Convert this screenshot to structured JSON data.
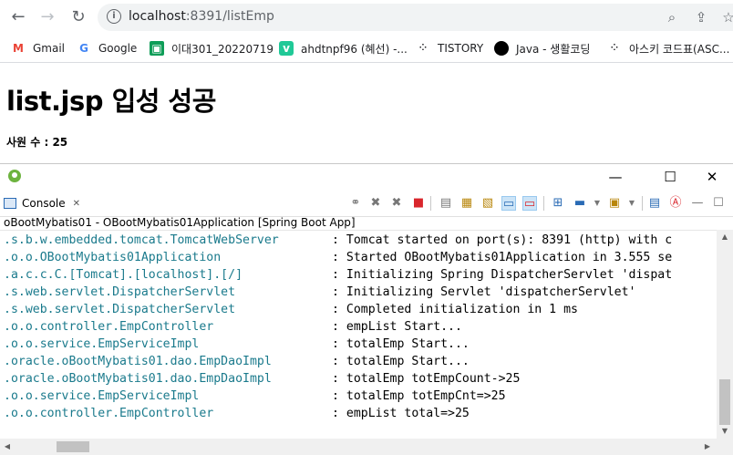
{
  "browser": {
    "url_host": "localhost",
    "url_rest": ":8391/listEmp",
    "nav_icons": [
      "back-arrow-icon",
      "forward-arrow-icon",
      "reload-icon"
    ],
    "right_icons": [
      "zoom-icon",
      "share-icon",
      "bookmark-star-icon"
    ]
  },
  "bookmarks": [
    {
      "label": "Gmail",
      "icon": "gmail-icon",
      "color": "#ea4335"
    },
    {
      "label": "Google",
      "icon": "google-icon",
      "color": "#4285f4"
    },
    {
      "label": "이대301_20220719",
      "icon": "classroom-icon",
      "color": "#0f9d58"
    },
    {
      "label": "ahdtnpf96 (혜선) -...",
      "icon": "velog-icon",
      "color": "#20c997"
    },
    {
      "label": "TISTORY",
      "icon": "tistory-icon",
      "color": "#000000"
    },
    {
      "label": "Java - 생활코딩",
      "icon": "opentutorials-icon",
      "color": "#000000"
    },
    {
      "label": "아스키 코드표(ASC...",
      "icon": "tistory-icon",
      "color": "#000000"
    }
  ],
  "page": {
    "title": "list.jsp 입성 성공",
    "count_label": "사원 수 : 25"
  },
  "eclipse": {
    "window_controls": [
      "minimize-icon",
      "maximize-icon",
      "close-icon"
    ],
    "tab_label": "Console",
    "process_label": "oBootMybatis01 - OBootMybatis01Application [Spring Boot App]",
    "log_lines": [
      {
        "logger": ".s.b.w.embedded.tomcat.TomcatWebServer",
        "message": ": Tomcat started on port(s): 8391 (http) with c"
      },
      {
        "logger": ".o.o.OBootMybatis01Application",
        "message": ": Started OBootMybatis01Application in 3.555 se"
      },
      {
        "logger": ".a.c.c.C.[Tomcat].[localhost].[/]",
        "message": ": Initializing Spring DispatcherServlet 'dispat"
      },
      {
        "logger": ".s.web.servlet.DispatcherServlet",
        "message": ": Initializing Servlet 'dispatcherServlet'"
      },
      {
        "logger": ".s.web.servlet.DispatcherServlet",
        "message": ": Completed initialization in 1 ms"
      },
      {
        "logger": ".o.o.controller.EmpController",
        "message": ": empList Start..."
      },
      {
        "logger": ".o.o.service.EmpServiceImpl",
        "message": ": totalEmp Start..."
      },
      {
        "logger": ".oracle.oBootMybatis01.dao.EmpDaoImpl",
        "message": ": totalEmp Start..."
      },
      {
        "logger": ".oracle.oBootMybatis01.dao.EmpDaoImpl",
        "message": ": totalEmp totEmpCount->25"
      },
      {
        "logger": ".o.o.service.EmpServiceImpl",
        "message": ": totalEmp totEmpCnt=>25"
      },
      {
        "logger": ".o.o.controller.EmpController",
        "message": ": empList total=>25"
      }
    ]
  }
}
